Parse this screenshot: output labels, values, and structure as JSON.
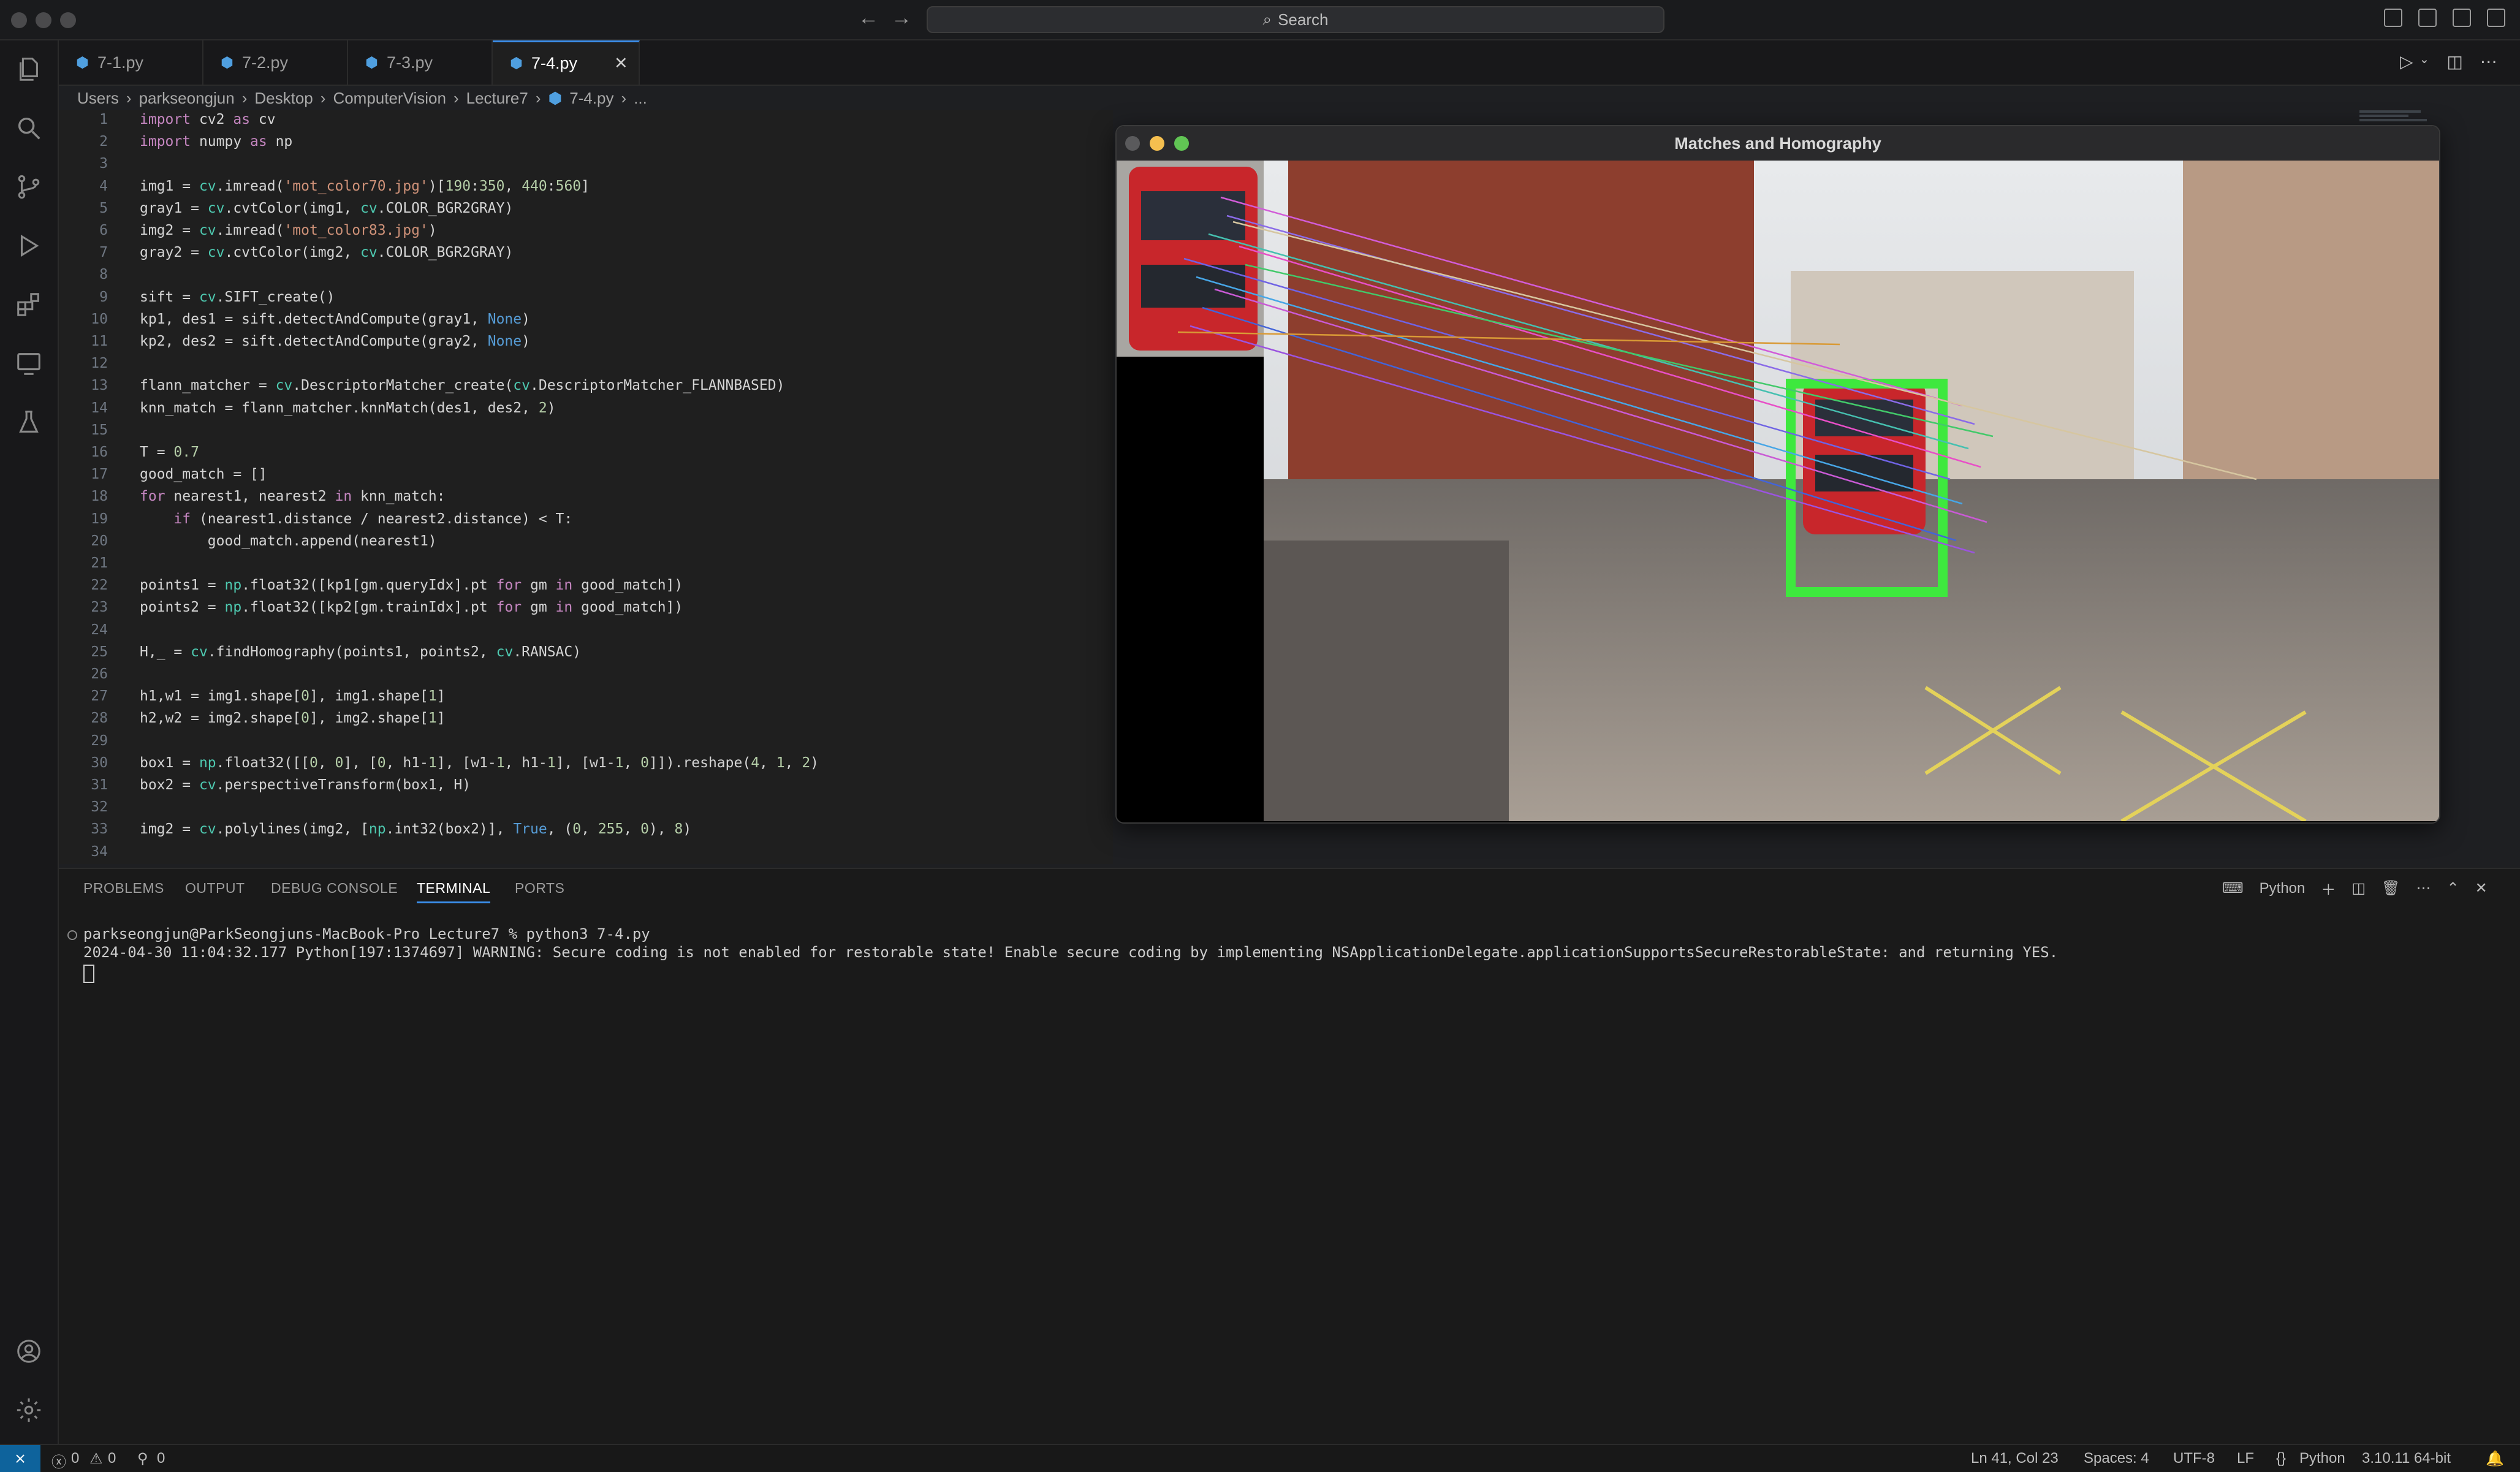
{
  "titlebar": {
    "search_label": "Search"
  },
  "tabs": [
    {
      "label": "7-1.py"
    },
    {
      "label": "7-2.py"
    },
    {
      "label": "7-3.py"
    },
    {
      "label": "7-4.py"
    }
  ],
  "breadcrumb": [
    "Users",
    "parkseongjun",
    "Desktop",
    "ComputerVision",
    "Lecture7",
    "7-4.py",
    "..."
  ],
  "editor": {
    "lines": [
      "import cv2 as cv",
      "import numpy as np",
      "",
      "img1 = cv.imread('mot_color70.jpg')[190:350, 440:560]",
      "gray1 = cv.cvtColor(img1, cv.COLOR_BGR2GRAY)",
      "img2 = cv.imread('mot_color83.jpg')",
      "gray2 = cv.cvtColor(img2, cv.COLOR_BGR2GRAY)",
      "",
      "sift = cv.SIFT_create()",
      "kp1, des1 = sift.detectAndCompute(gray1, None)",
      "kp2, des2 = sift.detectAndCompute(gray2, None)",
      "",
      "flann_matcher = cv.DescriptorMatcher_create(cv.DescriptorMatcher_FLANNBASED)",
      "knn_match = flann_matcher.knnMatch(des1, des2, 2)",
      "",
      "T = 0.7",
      "good_match = []",
      "for nearest1, nearest2 in knn_match:",
      "    if (nearest1.distance / nearest2.distance) < T:",
      "        good_match.append(nearest1)",
      "",
      "points1 = np.float32([kp1[gm.queryIdx].pt for gm in good_match])",
      "points2 = np.float32([kp2[gm.trainIdx].pt for gm in good_match])",
      "",
      "H,_ = cv.findHomography(points1, points2, cv.RANSAC)",
      "",
      "h1,w1 = img1.shape[0], img1.shape[1]",
      "h2,w2 = img2.shape[0], img2.shape[1]",
      "",
      "box1 = np.float32([[0, 0], [0, h1-1], [w1-1, h1-1], [w1-1, 0]]).reshape(4, 1, 2)",
      "box2 = cv.perspectiveTransform(box1, H)",
      "",
      "img2 = cv.polylines(img2, [np.int32(box2)], True, (0, 255, 0), 8)",
      ""
    ]
  },
  "image_window": {
    "title": "Matches and Homography"
  },
  "panel": {
    "tabs": [
      "PROBLEMS",
      "OUTPUT",
      "DEBUG CONSOLE",
      "TERMINAL",
      "PORTS"
    ],
    "active_tab": "TERMINAL",
    "shell_label": "Python",
    "terminal_lines": [
      "parkseongjun@ParkSeongjuns-MacBook-Pro Lecture7 % python3 7-4.py",
      "2024-04-30 11:04:32.177 Python[197:1374697] WARNING: Secure coding is not enabled for restorable state! Enable secure coding by implementing NSApplicationDelegate.applicationSupportsSecureRestorableState: and returning YES."
    ]
  },
  "statusbar": {
    "errors": "0",
    "warnings": "0",
    "ports": "0",
    "position": "Ln 41, Col 23",
    "spaces": "Spaces: 4",
    "encoding": "UTF-8",
    "eol": "LF",
    "language": "Python",
    "interpreter": "3.10.11 64-bit"
  },
  "colors": {
    "accent": "#3b8eea",
    "remote": "#0e639c",
    "box": "#3ee83e"
  }
}
